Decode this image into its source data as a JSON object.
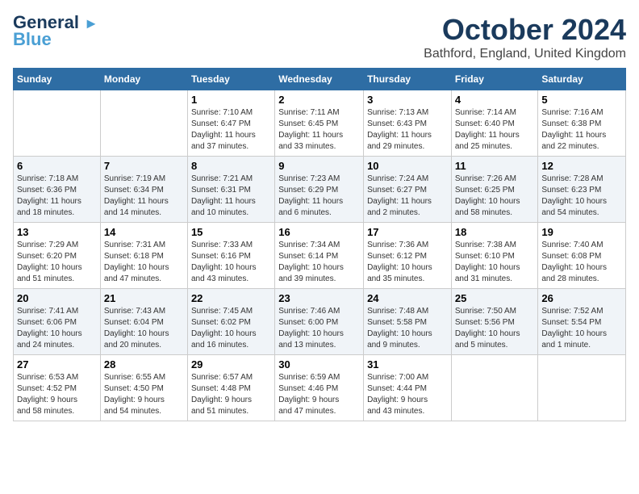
{
  "header": {
    "logo_line1": "General",
    "logo_line2": "Blue",
    "month_title": "October 2024",
    "subtitle": "Bathford, England, United Kingdom"
  },
  "days_of_week": [
    "Sunday",
    "Monday",
    "Tuesday",
    "Wednesday",
    "Thursday",
    "Friday",
    "Saturday"
  ],
  "weeks": [
    [
      {
        "day": "",
        "detail": ""
      },
      {
        "day": "",
        "detail": ""
      },
      {
        "day": "1",
        "detail": "Sunrise: 7:10 AM\nSunset: 6:47 PM\nDaylight: 11 hours\nand 37 minutes."
      },
      {
        "day": "2",
        "detail": "Sunrise: 7:11 AM\nSunset: 6:45 PM\nDaylight: 11 hours\nand 33 minutes."
      },
      {
        "day": "3",
        "detail": "Sunrise: 7:13 AM\nSunset: 6:43 PM\nDaylight: 11 hours\nand 29 minutes."
      },
      {
        "day": "4",
        "detail": "Sunrise: 7:14 AM\nSunset: 6:40 PM\nDaylight: 11 hours\nand 25 minutes."
      },
      {
        "day": "5",
        "detail": "Sunrise: 7:16 AM\nSunset: 6:38 PM\nDaylight: 11 hours\nand 22 minutes."
      }
    ],
    [
      {
        "day": "6",
        "detail": "Sunrise: 7:18 AM\nSunset: 6:36 PM\nDaylight: 11 hours\nand 18 minutes."
      },
      {
        "day": "7",
        "detail": "Sunrise: 7:19 AM\nSunset: 6:34 PM\nDaylight: 11 hours\nand 14 minutes."
      },
      {
        "day": "8",
        "detail": "Sunrise: 7:21 AM\nSunset: 6:31 PM\nDaylight: 11 hours\nand 10 minutes."
      },
      {
        "day": "9",
        "detail": "Sunrise: 7:23 AM\nSunset: 6:29 PM\nDaylight: 11 hours\nand 6 minutes."
      },
      {
        "day": "10",
        "detail": "Sunrise: 7:24 AM\nSunset: 6:27 PM\nDaylight: 11 hours\nand 2 minutes."
      },
      {
        "day": "11",
        "detail": "Sunrise: 7:26 AM\nSunset: 6:25 PM\nDaylight: 10 hours\nand 58 minutes."
      },
      {
        "day": "12",
        "detail": "Sunrise: 7:28 AM\nSunset: 6:23 PM\nDaylight: 10 hours\nand 54 minutes."
      }
    ],
    [
      {
        "day": "13",
        "detail": "Sunrise: 7:29 AM\nSunset: 6:20 PM\nDaylight: 10 hours\nand 51 minutes."
      },
      {
        "day": "14",
        "detail": "Sunrise: 7:31 AM\nSunset: 6:18 PM\nDaylight: 10 hours\nand 47 minutes."
      },
      {
        "day": "15",
        "detail": "Sunrise: 7:33 AM\nSunset: 6:16 PM\nDaylight: 10 hours\nand 43 minutes."
      },
      {
        "day": "16",
        "detail": "Sunrise: 7:34 AM\nSunset: 6:14 PM\nDaylight: 10 hours\nand 39 minutes."
      },
      {
        "day": "17",
        "detail": "Sunrise: 7:36 AM\nSunset: 6:12 PM\nDaylight: 10 hours\nand 35 minutes."
      },
      {
        "day": "18",
        "detail": "Sunrise: 7:38 AM\nSunset: 6:10 PM\nDaylight: 10 hours\nand 31 minutes."
      },
      {
        "day": "19",
        "detail": "Sunrise: 7:40 AM\nSunset: 6:08 PM\nDaylight: 10 hours\nand 28 minutes."
      }
    ],
    [
      {
        "day": "20",
        "detail": "Sunrise: 7:41 AM\nSunset: 6:06 PM\nDaylight: 10 hours\nand 24 minutes."
      },
      {
        "day": "21",
        "detail": "Sunrise: 7:43 AM\nSunset: 6:04 PM\nDaylight: 10 hours\nand 20 minutes."
      },
      {
        "day": "22",
        "detail": "Sunrise: 7:45 AM\nSunset: 6:02 PM\nDaylight: 10 hours\nand 16 minutes."
      },
      {
        "day": "23",
        "detail": "Sunrise: 7:46 AM\nSunset: 6:00 PM\nDaylight: 10 hours\nand 13 minutes."
      },
      {
        "day": "24",
        "detail": "Sunrise: 7:48 AM\nSunset: 5:58 PM\nDaylight: 10 hours\nand 9 minutes."
      },
      {
        "day": "25",
        "detail": "Sunrise: 7:50 AM\nSunset: 5:56 PM\nDaylight: 10 hours\nand 5 minutes."
      },
      {
        "day": "26",
        "detail": "Sunrise: 7:52 AM\nSunset: 5:54 PM\nDaylight: 10 hours\nand 1 minute."
      }
    ],
    [
      {
        "day": "27",
        "detail": "Sunrise: 6:53 AM\nSunset: 4:52 PM\nDaylight: 9 hours\nand 58 minutes."
      },
      {
        "day": "28",
        "detail": "Sunrise: 6:55 AM\nSunset: 4:50 PM\nDaylight: 9 hours\nand 54 minutes."
      },
      {
        "day": "29",
        "detail": "Sunrise: 6:57 AM\nSunset: 4:48 PM\nDaylight: 9 hours\nand 51 minutes."
      },
      {
        "day": "30",
        "detail": "Sunrise: 6:59 AM\nSunset: 4:46 PM\nDaylight: 9 hours\nand 47 minutes."
      },
      {
        "day": "31",
        "detail": "Sunrise: 7:00 AM\nSunset: 4:44 PM\nDaylight: 9 hours\nand 43 minutes."
      },
      {
        "day": "",
        "detail": ""
      },
      {
        "day": "",
        "detail": ""
      }
    ]
  ]
}
